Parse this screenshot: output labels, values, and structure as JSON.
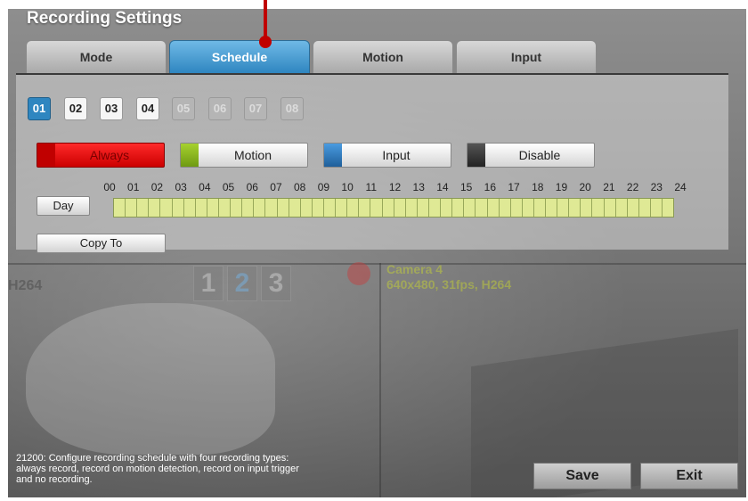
{
  "window": {
    "title": "Recording Settings"
  },
  "tabs": [
    {
      "label": "Mode"
    },
    {
      "label": "Schedule",
      "active": true
    },
    {
      "label": "Motion"
    },
    {
      "label": "Input"
    }
  ],
  "channels": [
    {
      "label": "01",
      "state": "selected"
    },
    {
      "label": "02",
      "state": "enabled"
    },
    {
      "label": "03",
      "state": "enabled"
    },
    {
      "label": "04",
      "state": "enabled"
    },
    {
      "label": "05",
      "state": "disabled"
    },
    {
      "label": "06",
      "state": "disabled"
    },
    {
      "label": "07",
      "state": "disabled"
    },
    {
      "label": "08",
      "state": "disabled"
    }
  ],
  "recording_types": [
    {
      "label": "Always",
      "color": "#e00000",
      "selected": true
    },
    {
      "label": "Motion",
      "color": "#7fae1c"
    },
    {
      "label": "Input",
      "color": "#2b7cc0"
    },
    {
      "label": "Disable",
      "color": "#444444"
    }
  ],
  "schedule": {
    "hour_labels": [
      "00",
      "01",
      "02",
      "03",
      "04",
      "05",
      "06",
      "07",
      "08",
      "09",
      "10",
      "11",
      "12",
      "13",
      "14",
      "15",
      "16",
      "17",
      "18",
      "19",
      "20",
      "21",
      "22",
      "23",
      "24"
    ],
    "day_button": "Day",
    "copy_button": "Copy To",
    "cells_per_hour": 2,
    "fill_color": "#dfe995"
  },
  "background_view": {
    "codec_left": "H264",
    "channel_digits": [
      "1",
      "2",
      "3"
    ],
    "camera_name": "Camera 4",
    "camera_info": "640x480, 31fps, H264"
  },
  "footer": {
    "help_lines": [
      "21200: Configure recording schedule with four recording types:",
      "always record, record on motion detection, record on input trigger",
      "and no recording."
    ],
    "save_label": "Save",
    "exit_label": "Exit"
  }
}
